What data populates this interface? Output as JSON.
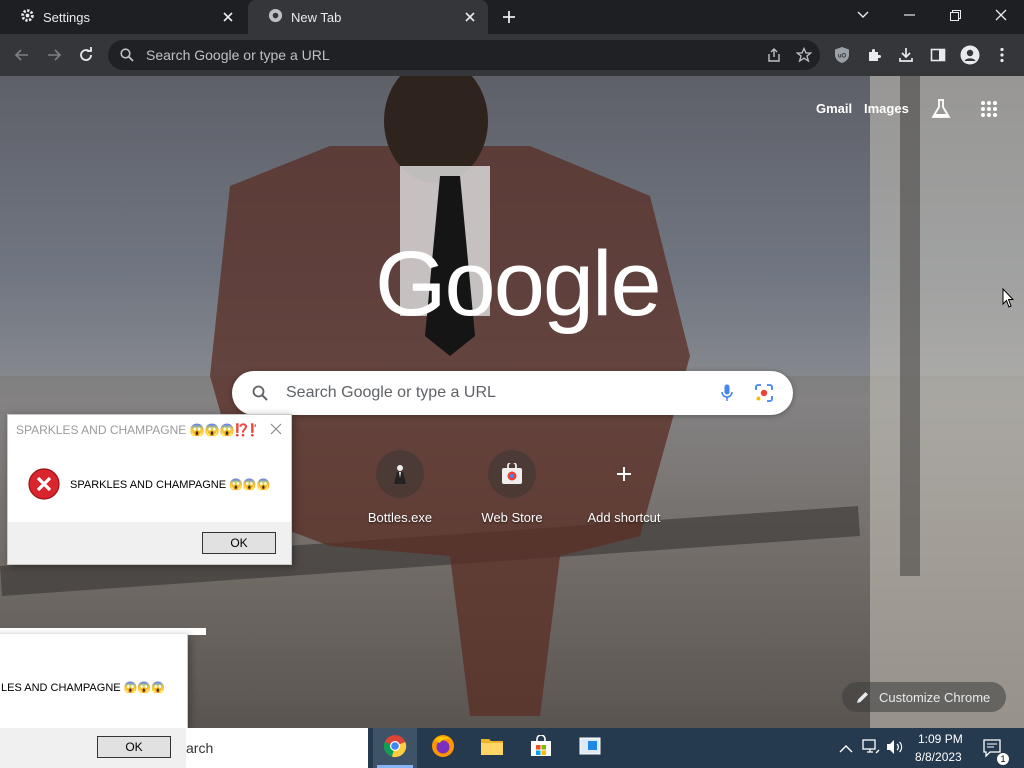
{
  "browser": {
    "tabs": [
      {
        "label": "Settings",
        "icon": "gear-icon",
        "active": false
      },
      {
        "label": "New Tab",
        "icon": "chrome-icon",
        "active": true
      }
    ],
    "omnibox_placeholder": "Search Google or type a URL",
    "toolbar_icons": [
      "back-icon",
      "forward-icon",
      "reload-icon",
      "share-icon",
      "star-icon",
      "ublock-icon",
      "extensions-icon",
      "download-icon",
      "side-panel-icon",
      "profile-icon",
      "menu-icon"
    ]
  },
  "ntp": {
    "links": {
      "gmail": "Gmail",
      "images": "Images"
    },
    "logo": "Google",
    "search_placeholder": "Search Google or type a URL",
    "shortcuts": [
      {
        "label": "Bottles.exe"
      },
      {
        "label": "Web Store"
      },
      {
        "label": "Add shortcut"
      }
    ],
    "customize_label": "Customize Chrome"
  },
  "dialog1": {
    "title": "SPARKLES AND CHAMPAGNE 😱😱😱⁉️⁉️",
    "message": "SPARKLES AND CHAMPAGNE 😱😱😱",
    "ok": "OK"
  },
  "dialog2": {
    "message": "LES AND CHAMPAGNE 😱😱😱",
    "ok": "OK"
  },
  "taskbar": {
    "search_text": "arch",
    "apps": [
      "chrome-icon",
      "firefox-icon",
      "file-explorer-icon",
      "store-icon",
      "app-window-icon"
    ],
    "time": "1:09 PM",
    "date": "8/8/2023",
    "notification_count": "1"
  },
  "colors": {
    "tabstrip": "#1e1f22",
    "toolbar": "#35363a",
    "taskbar": "#263a4f",
    "accent": "#8ab4f8"
  }
}
